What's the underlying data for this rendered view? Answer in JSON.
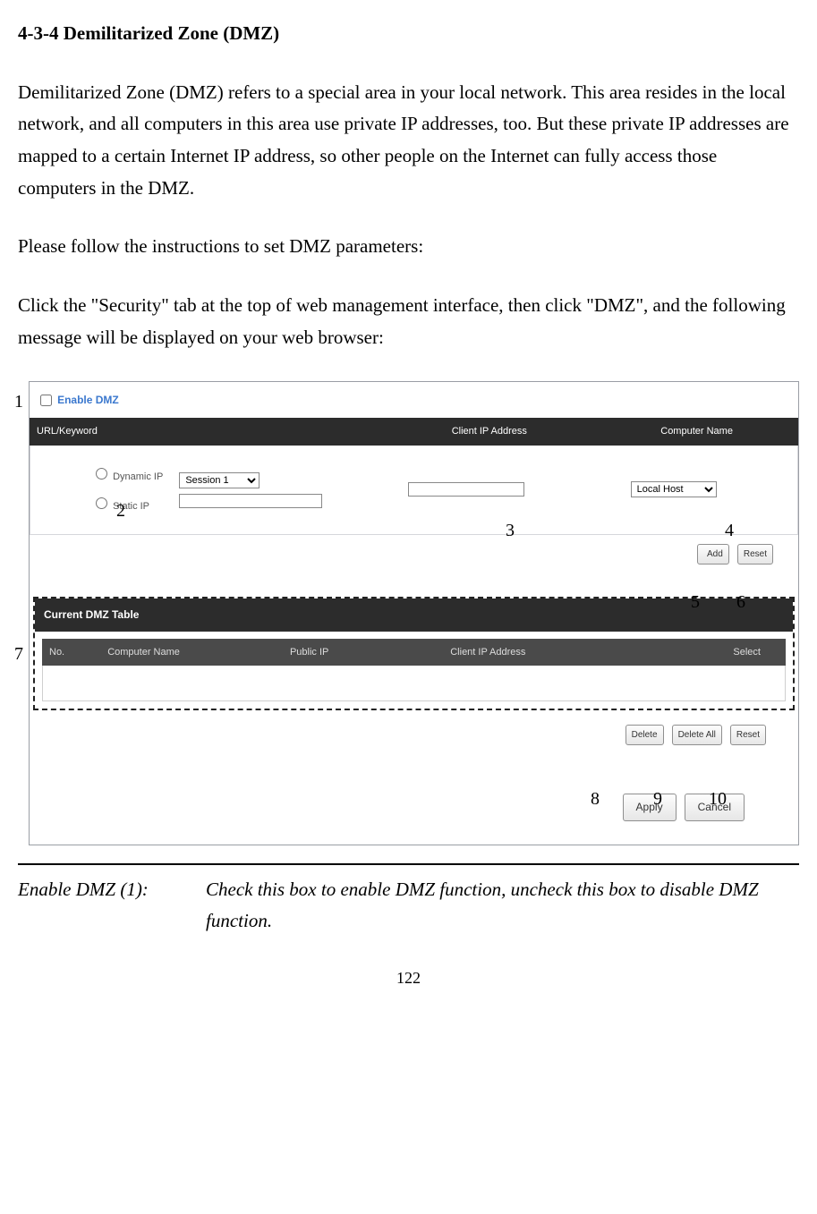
{
  "heading": "4-3-4 Demilitarized Zone (DMZ)",
  "para1": "Demilitarized Zone (DMZ) refers to a special area in your local network. This area resides in the local network, and all computers in this area use private IP addresses, too. But these private IP addresses are mapped to a certain Internet IP address, so other people on the Internet can fully access those computers in the DMZ.",
  "para2": "Please follow the instructions to set DMZ parameters:",
  "para3": "Click the \"Security\" tab at the top of web management interface, then click \"DMZ\", and the following message will be displayed on your web browser:",
  "annotations": {
    "a1": "1",
    "a2": "2",
    "a3": "3",
    "a4": "4",
    "a5": "5",
    "a6": "6",
    "a7": "7",
    "a8": "8",
    "a9": "9",
    "a10": "10"
  },
  "ui": {
    "enable_label": "Enable DMZ",
    "hdr_url": "URL/Keyword",
    "hdr_clientip": "Client IP Address",
    "hdr_cname": "Computer Name",
    "radio_dyn": "Dynamic IP",
    "radio_static": "Static IP",
    "session_sel": "Session 1",
    "localhost_sel": "Local Host",
    "btn_add": "Add",
    "btn_reset": "Reset",
    "table_title": "Current DMZ Table",
    "th_no": "No.",
    "th_cn": "Computer Name",
    "th_pip": "Public IP",
    "th_cip": "Client IP Address",
    "th_sel": "Select",
    "btn_delete": "Delete",
    "btn_deleteall": "Delete All",
    "btn_reset2": "Reset",
    "btn_apply": "Apply",
    "btn_cancel": "Cancel"
  },
  "desc": {
    "label": "Enable DMZ (1):",
    "text": "Check this box to enable DMZ function, uncheck this box to disable DMZ function."
  },
  "pagenum": "122"
}
